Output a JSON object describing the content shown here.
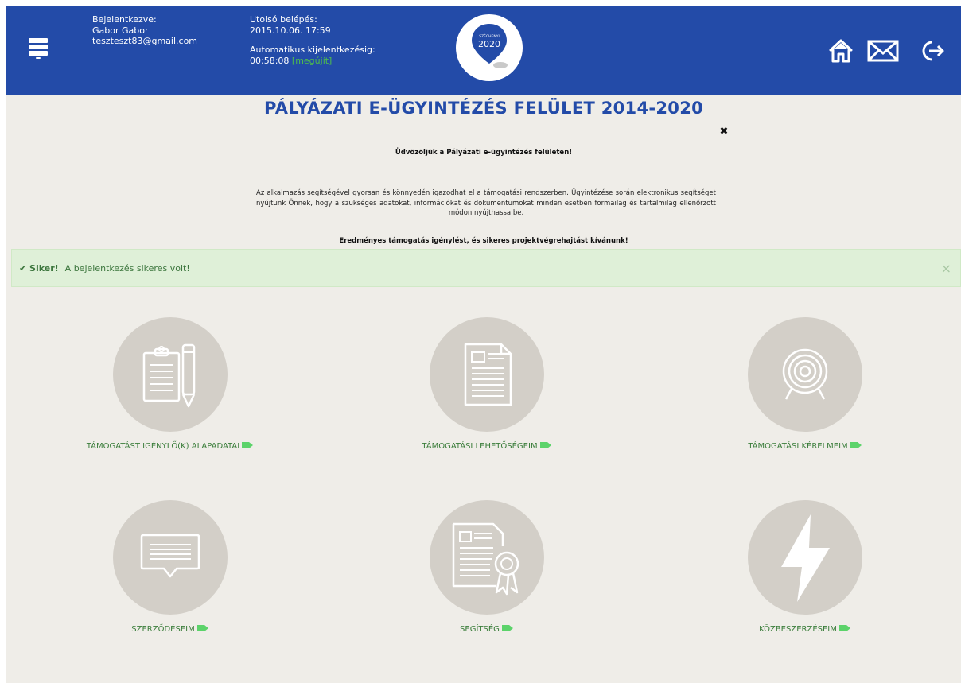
{
  "header": {
    "logged_in_label": "Bejelentkezve:",
    "user_name": "Gabor Gabor",
    "user_email": "teszteszt83@gmail.com",
    "last_login_label": "Utolsó belépés:",
    "last_login_value": "2015.10.06. 17:59",
    "auto_logout_label": "Automatikus kijelentkezésig:",
    "auto_logout_value": "00:58:08",
    "renew_link": "[megújít]",
    "logo_text_top": "SZÉCHENYI",
    "logo_text_year": "2020",
    "icons": [
      "menu-icon",
      "home-icon",
      "mail-icon",
      "logout-icon"
    ]
  },
  "main": {
    "title": "PÁLYÁZATI E-ÜGYINTÉZÉS FELÜLET 2014-2020",
    "close_glyph": "✖",
    "welcome": "Üdvözöljük a Pályázati e-ügyintézés felületen!",
    "intro": "Az alkalmazás segítségével gyorsan és könnyedén igazodhat el a támogatási rendszerben. Ügyintézése során elektronikus segítséget nyújtunk Önnek, hogy a szükséges adatokat, információkat és dokumentumokat minden esetben formailag és tartalmilag ellenőrzött módon nyújthassa be.",
    "closing": "Eredményes támogatás igénylést, és sikeres projektvégrehajtást kívánunk!"
  },
  "alert": {
    "strong": "✔ Siker!",
    "message": "A bejelentkezés sikeres volt!",
    "close_glyph": "×"
  },
  "tiles": [
    {
      "label": "TÁMOGATÁST IGÉNYLŐ(K) ALAPADATAI",
      "icon": "clipboard-pencil-icon"
    },
    {
      "label": "TÁMOGATÁSI LEHETŐSÉGEIM",
      "icon": "document-icon"
    },
    {
      "label": "TÁMOGATÁSI KÉRELMEIM",
      "icon": "target-icon"
    },
    {
      "label": "SZERZŐDÉSEIM",
      "icon": "speech-bubble-icon"
    },
    {
      "label": "SEGÍTSÉG",
      "icon": "certificate-icon"
    },
    {
      "label": "KÖZBESZERZÉSEIM",
      "icon": "lightning-icon"
    }
  ],
  "colors": {
    "header_bg": "#234ba8",
    "page_bg": "#efede8",
    "tile_circle": "#d3cfc8",
    "tile_label": "#3a7d3a",
    "arrow": "#5cd36a",
    "alert_bg": "#dff0d8"
  }
}
